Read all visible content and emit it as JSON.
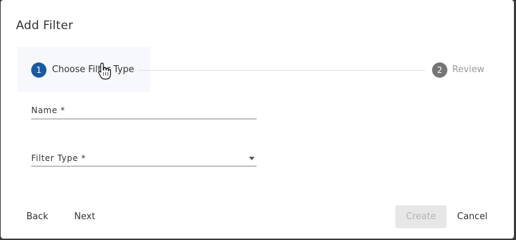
{
  "dialog": {
    "title": "Add Filter"
  },
  "stepper": {
    "steps": [
      {
        "number": "1",
        "label": "Choose Filter Type",
        "state": "active"
      },
      {
        "number": "2",
        "label": "Review",
        "state": "inactive"
      }
    ]
  },
  "form": {
    "name_label": "Name *",
    "filter_type_label": "Filter Type *"
  },
  "actions": {
    "back_label": "Back",
    "next_label": "Next",
    "create_label": "Create",
    "cancel_label": "Cancel"
  },
  "colors": {
    "accent": "#1c5aa0",
    "inactive_step": "#757575",
    "disabled_button": "#e7e7e7"
  }
}
